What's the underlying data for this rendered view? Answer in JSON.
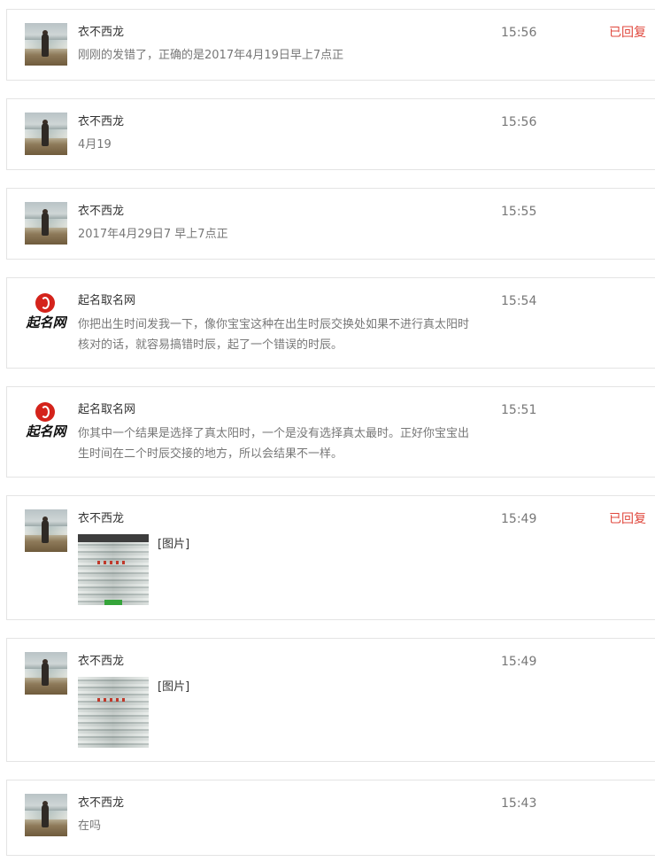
{
  "messages": [
    {
      "sender": "衣不西龙",
      "avatar": "beach-photo-avatar",
      "time": "15:56",
      "status": "已回复",
      "text": "刚刚的发错了，正确的是2017年4月19日早上7点正"
    },
    {
      "sender": "衣不西龙",
      "avatar": "beach-photo-avatar",
      "time": "15:56",
      "status": "",
      "text": "4月19"
    },
    {
      "sender": "衣不西龙",
      "avatar": "beach-photo-avatar",
      "time": "15:55",
      "status": "",
      "text": "2017年4月29日7 早上7点正"
    },
    {
      "sender": "起名取名网",
      "avatar": "site-logo-avatar",
      "avatar_text": "起名网",
      "time": "15:54",
      "status": "",
      "text_lines": [
        "你把出生时间发我一下，像你宝宝这种在出生时辰交换处如果不进行真太阳时",
        "核对的话，就容易搞错时辰，起了一个错误的时辰。"
      ]
    },
    {
      "sender": "起名取名网",
      "avatar": "site-logo-avatar",
      "avatar_text": "起名网",
      "time": "15:51",
      "status": "",
      "text_lines": [
        "你其中一个结果是选择了真太阳时，一个是没有选择真太最时。正好你宝宝出",
        "生时间在二个时辰交接的地方，所以会结果不一样。"
      ]
    },
    {
      "sender": "衣不西龙",
      "avatar": "beach-photo-avatar",
      "time": "15:49",
      "status": "已回复",
      "image_label": "[图片]"
    },
    {
      "sender": "衣不西龙",
      "avatar": "beach-photo-avatar",
      "time": "15:49",
      "status": "",
      "image_label": "[图片]"
    },
    {
      "sender": "衣不西龙",
      "avatar": "beach-photo-avatar",
      "time": "15:43",
      "status": "",
      "text": "在吗"
    }
  ],
  "colors": {
    "border": "#e4e4e4",
    "status_red": "#e0473c",
    "secondary_text": "#777777",
    "logo_red": "#d4231b"
  }
}
